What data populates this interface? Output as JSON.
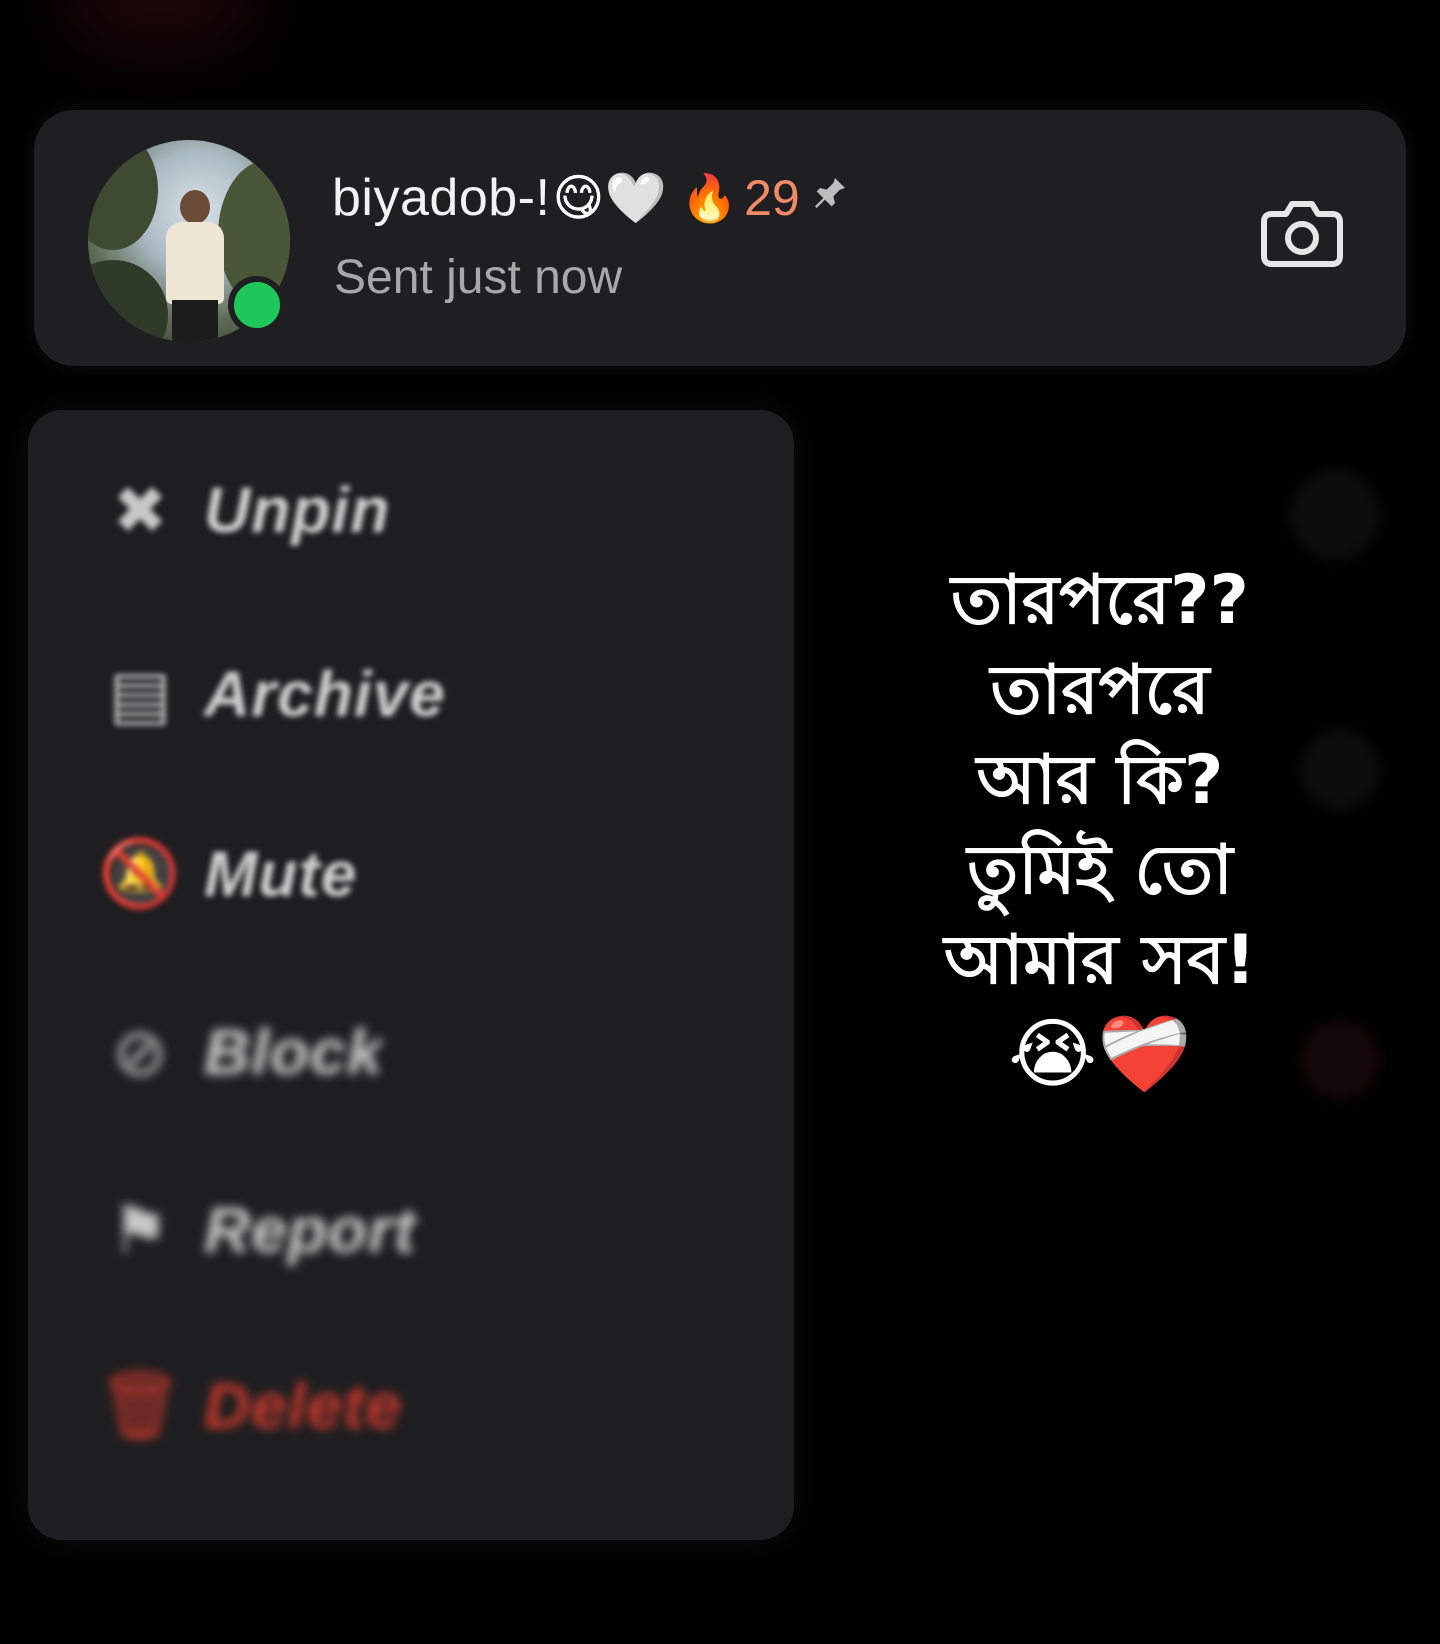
{
  "chat_header": {
    "username": "biyadob-!",
    "name_emojis": "😋🤍",
    "streak_emoji": "🔥",
    "streak_count": "29",
    "pin_icon": "pin-icon",
    "status": "Sent just now",
    "online": true,
    "camera_icon": "camera-icon"
  },
  "context_menu": {
    "items": [
      {
        "label": "Unpin",
        "icon": "unpin-icon",
        "icon_glyph": "✖"
      },
      {
        "label": "Archive",
        "icon": "archive-icon",
        "icon_glyph": "▤"
      },
      {
        "label": "Mute",
        "icon": "mute-icon",
        "icon_glyph": "🔕"
      },
      {
        "label": "Block",
        "icon": "block-icon",
        "icon_glyph": "⊘"
      },
      {
        "label": "Report",
        "icon": "report-icon",
        "icon_glyph": "⚑"
      },
      {
        "label": "Delete",
        "icon": "delete-icon",
        "icon_glyph": "🗑"
      }
    ]
  },
  "overlay": {
    "lines": [
      "তারপরে??",
      "তারপরে",
      "আর কি?",
      "তুমিই তো",
      "আমার সব!"
    ],
    "emojis": "😭❤️‍🩹"
  },
  "colors": {
    "background": "#000000",
    "card": "#1f1f21",
    "online": "#1fc75a",
    "streak": "#f08a67",
    "danger": "#c6392c"
  }
}
